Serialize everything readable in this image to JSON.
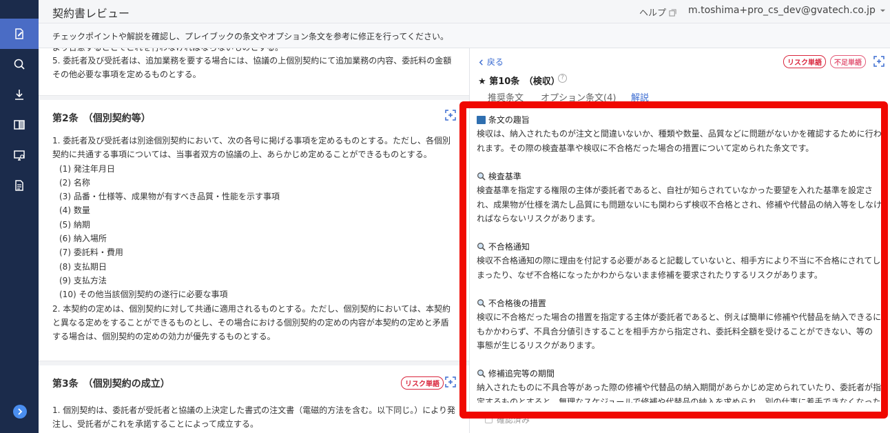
{
  "header": {
    "app_title": "契約書レビュー",
    "help_label": "ヘルプ",
    "user_email": "m.toshima+pro_cs_dev@gvatech.co.jp"
  },
  "instruction": "チェックポイントや解説を確認し、プレイブックの条文やオプション条文を参考に修正を行ってください。",
  "document": {
    "top_card": {
      "partial_line": "より合意することでこれを行わなければならないものとする。",
      "lines": [
        "5. 委託者及び受託者は、追加業務を要する場合には、協議の上個別契約にて追加業務の内容、委託料の金額",
        "その他必要な事項を定めるものとする。"
      ]
    },
    "article2": {
      "title": "第2条　（個別契約等）",
      "lines": [
        "1. 委託者及び受託者は別途個別契約において、次の各号に掲げる事項を定めるものとする。ただし、各個別",
        "契約に共通する事項については、当事者双方の協議の上、あらかじめ定めることができるものとする。",
        "(1) 発注年月日",
        "(2) 名称",
        "(3) 品番・仕様等、成果物が有すべき品質・性能を示す事項",
        "(4) 数量",
        "(5) 納期",
        "(6) 納入場所",
        "(7) 委託料・費用",
        "(8) 支払期日",
        "(9) 支払方法",
        "(10) その他当該個別契約の遂行に必要な事項",
        "2. 本契約の定めは、個別契約に対して共通に適用されるものとする。ただし、個別契約においては、本契約",
        "と異なる定めをすることができるものとし、その場合における個別契約の定めの内容が本契約の定めと矛盾",
        "する場合は、個別契約の定めの効力が優先するものとする。"
      ]
    },
    "article3": {
      "title": "第3条　（個別契約の成立）",
      "badge": "リスク単語",
      "lines": [
        "1. 個別契約は、委託者が受託者と協議の上決定した書式の注文書（電磁的方法を含む。以下同じ。）により発",
        "注し、受託者がこれを承諾することによって成立する。"
      ]
    }
  },
  "panel": {
    "back_label": "戻る",
    "badge_risk": "リスク単語",
    "badge_lack": "不足単語",
    "article_title": "第10条　（検収）",
    "help_icon": "?",
    "tabs": [
      "推奨条文",
      "オプション条文(4)",
      "解説"
    ],
    "active_tab": "解説",
    "sections": [
      {
        "icon": "book-icon",
        "heading": "条文の趣旨",
        "lines": [
          "検収は、納入されたものが注文と間違いないか、種類や数量、品質などに問題がないかを確認するために行わ",
          "れます。その際の検査基準や検収に不合格だった場合の措置について定められた条文です。"
        ]
      },
      {
        "icon": "magnifier-icon",
        "heading": "検査基準",
        "lines": [
          "検査基準を指定する権限の主体が委託者であると、自社が知らされていなかった要望を入れた基準を設定さ",
          "れ、成果物が仕様を満たし品質にも問題ないにも関わらず検収不合格とされ、修補や代替品の納入等をしなけ",
          "ればならないリスクがあります。"
        ]
      },
      {
        "icon": "magnifier-icon",
        "heading": "不合格通知",
        "lines": [
          "検収不合格通知の際に理由を付記する必要があると記載していないと、相手方により不当に不合格にされてし",
          "まったり、なぜ不合格になったかわからないまま修補を要求されたりするリスクがあります。"
        ]
      },
      {
        "icon": "magnifier-icon",
        "heading": "不合格後の措置",
        "lines": [
          "検収に不合格だった場合の措置を指定する主体が委託者であると、例えば簡単に修補や代替品を納入できるに",
          "もかかわらず、不具合分値引きすることを相手方から指定され、委託料全額を受けることができない、等の",
          "事態が生じるリスクがあります。"
        ]
      },
      {
        "icon": "magnifier-icon",
        "heading": "修補追完等の期間",
        "lines": [
          "納入されたものに不具合等があった際の修補や代替品の納入期間があらかじめ定められていたり、委託者が指",
          "定するものとすると、無理なスケジュールで修補や代替品の納入を求められ、別の仕事に着手できなくなった"
        ]
      }
    ],
    "checkbox_label": "確認済み"
  },
  "colors": {
    "sidebar": "#1b2b4b",
    "sidebar_active": "#4a6cc5",
    "accent": "#3a6bd1",
    "risk_badge": "#d9243b",
    "highlight": "#f00800"
  }
}
